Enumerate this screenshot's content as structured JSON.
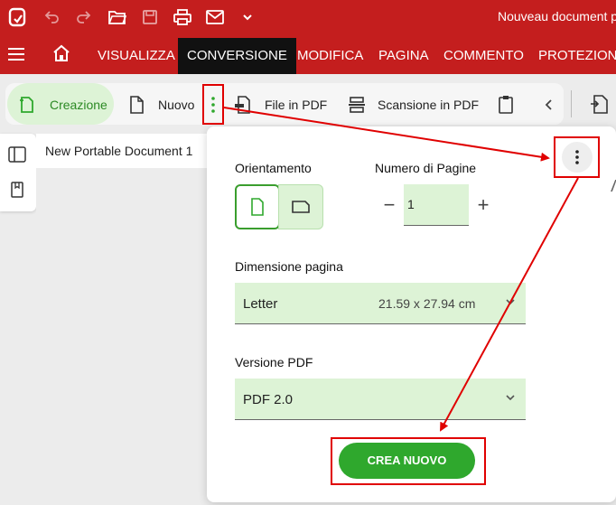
{
  "titlebar": {
    "doc_title": "Nouveau document p"
  },
  "tabs": [
    {
      "label": "VISUALIZZA"
    },
    {
      "label": "CONVERSIONE"
    },
    {
      "label": "MODIFICA"
    },
    {
      "label": "PAGINA"
    },
    {
      "label": "COMMENTO"
    },
    {
      "label": "PROTEZIONE"
    }
  ],
  "toolbar": {
    "create": "Creazione",
    "new": "Nuovo",
    "file_to_pdf": "File in PDF",
    "scan_to_pdf": "Scansione in PDF"
  },
  "document": {
    "tab_title": "New Portable Document 1"
  },
  "panel": {
    "orientation_label": "Orientamento",
    "pages_label": "Numero di Pagine",
    "pages_value": "1",
    "page_size_label": "Dimensione pagina",
    "page_size_value": "Letter",
    "page_size_dims": "21.59 x 27.94 cm",
    "pdf_version_label": "Versione PDF",
    "pdf_version_value": "PDF 2.0",
    "create_button": "CREA NUOVO"
  },
  "colors": {
    "brand_red": "#c41e1e",
    "accent_green": "#2fa82d",
    "annotation_red": "#e00000"
  }
}
